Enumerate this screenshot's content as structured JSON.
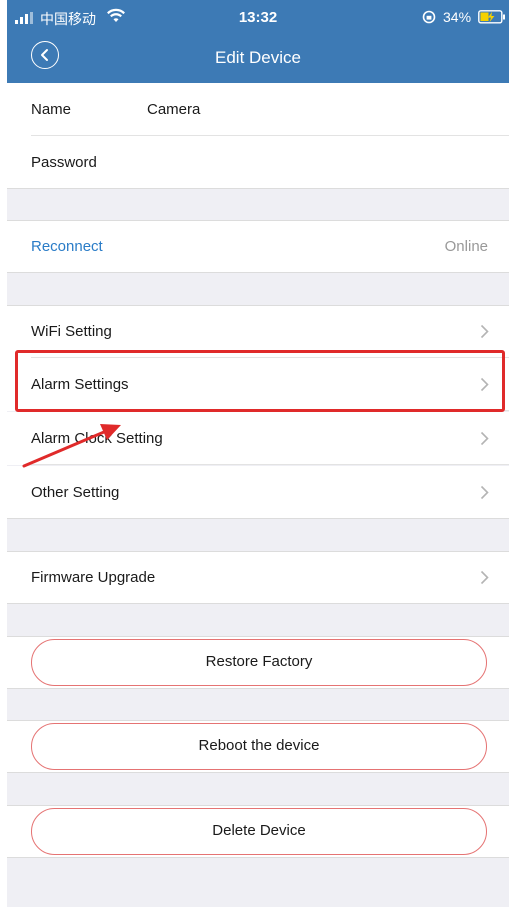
{
  "status_bar": {
    "carrier": "中国移动",
    "time": "13:32",
    "battery_percent": "34%"
  },
  "header": {
    "title": "Edit Device",
    "back_icon": "chevron-left-icon"
  },
  "device": {
    "name_label": "Name",
    "name_value": "Camera",
    "password_label": "Password"
  },
  "connection": {
    "reconnect_label": "Reconnect",
    "status": "Online"
  },
  "settings": {
    "wifi": "WiFi Setting",
    "alarm": "Alarm Settings",
    "alarm_clock": "Alarm Clock Setting",
    "other": "Other Setting"
  },
  "firmware": {
    "upgrade": "Firmware Upgrade"
  },
  "actions": {
    "restore": "Restore Factory",
    "reboot": "Reboot the device",
    "delete": "Delete Device"
  },
  "colors": {
    "header_bg": "#3d7ab5",
    "link_blue": "#2a7cc7",
    "annotation_red": "#e02a2a",
    "button_border": "#e57373"
  }
}
